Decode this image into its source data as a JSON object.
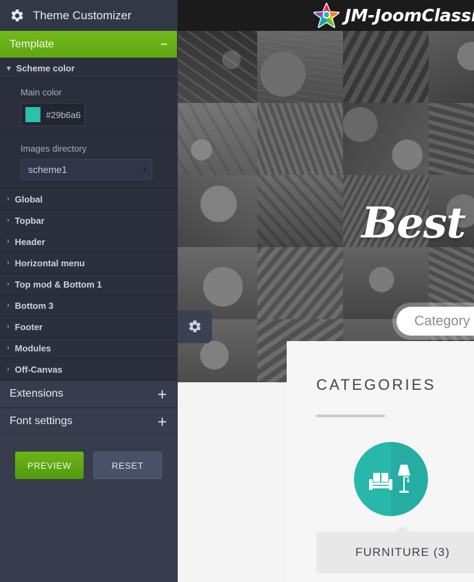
{
  "site": {
    "brand": {
      "logo_icon": "rainbow-star-icon",
      "name": "JM-JoomClassi"
    },
    "hero": {
      "title": "Best",
      "search_placeholder": "Category",
      "settings_icon": "gear-icon"
    },
    "categories": {
      "heading": "CATEGORIES",
      "items": [
        {
          "icon": "sofa-lamp-icon",
          "label": "FURNITURE (3)",
          "circle_color": "#27b7ab"
        }
      ]
    }
  },
  "customizer": {
    "header": {
      "icon": "gear-icon",
      "title": "Theme Customizer"
    },
    "sections": [
      {
        "label": "Template",
        "state": "expanded",
        "sign": "−",
        "active": true
      }
    ],
    "scheme_color": {
      "label": "Scheme color",
      "chevron": "chevron-down-icon",
      "main_color": {
        "label": "Main color",
        "value": "#29b6a6",
        "swatch": "#2cbfab"
      },
      "images_directory": {
        "label": "Images directory",
        "value": "scheme1",
        "caret": "▾"
      }
    },
    "items": [
      {
        "label": "Global",
        "chevron": "chevron-right-icon"
      },
      {
        "label": "Topbar",
        "chevron": "chevron-right-icon"
      },
      {
        "label": "Header",
        "chevron": "chevron-right-icon"
      },
      {
        "label": "Horizontal menu",
        "chevron": "chevron-right-icon"
      },
      {
        "label": "Top mod & Bottom 1",
        "chevron": "chevron-right-icon"
      },
      {
        "label": "Bottom 3",
        "chevron": "chevron-right-icon"
      },
      {
        "label": "Footer",
        "chevron": "chevron-right-icon"
      },
      {
        "label": "Modules",
        "chevron": "chevron-right-icon"
      },
      {
        "label": "Off-Canvas",
        "chevron": "chevron-right-icon"
      }
    ],
    "collapsed_sections": [
      {
        "label": "Extensions",
        "sign": "＋"
      },
      {
        "label": "Font settings",
        "sign": "＋"
      }
    ],
    "buttons": {
      "preview": "PREVIEW",
      "reset": "RESET"
    }
  },
  "colors": {
    "accent_green": "#5fa512",
    "teal": "#29b6a6",
    "sidebar_bg": "#383d4d",
    "sidebar_panel": "#2c303d",
    "topbar_bg": "#1b1b1b"
  }
}
